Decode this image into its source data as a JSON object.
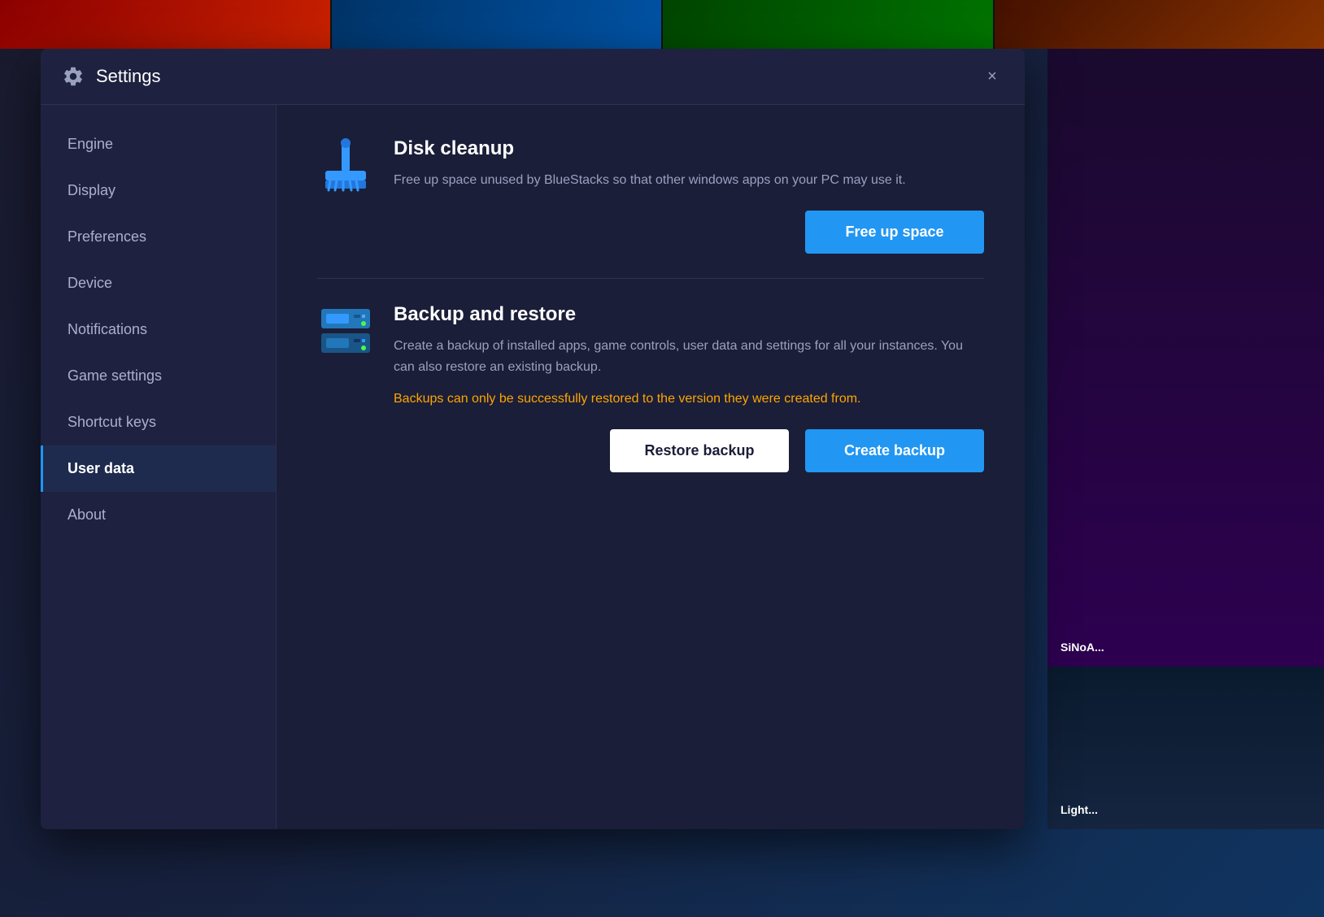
{
  "window": {
    "title": "Settings",
    "close_label": "×"
  },
  "sidebar": {
    "items": [
      {
        "id": "engine",
        "label": "Engine",
        "active": false
      },
      {
        "id": "display",
        "label": "Display",
        "active": false
      },
      {
        "id": "preferences",
        "label": "Preferences",
        "active": false
      },
      {
        "id": "device",
        "label": "Device",
        "active": false
      },
      {
        "id": "notifications",
        "label": "Notifications",
        "active": false
      },
      {
        "id": "game-settings",
        "label": "Game settings",
        "active": false
      },
      {
        "id": "shortcut-keys",
        "label": "Shortcut keys",
        "active": false
      },
      {
        "id": "user-data",
        "label": "User data",
        "active": true
      },
      {
        "id": "about",
        "label": "About",
        "active": false
      }
    ]
  },
  "disk_cleanup": {
    "title": "Disk cleanup",
    "description": "Free up space unused by BlueStacks so that other windows apps on your PC may use it.",
    "button_label": "Free up space"
  },
  "backup_restore": {
    "title": "Backup and restore",
    "description": "Create a backup of installed apps, game controls, user data and settings for all your instances. You can also restore an existing backup.",
    "warning": "Backups can only be successfully restored to the version they were created from.",
    "restore_button": "Restore backup",
    "create_button": "Create backup"
  },
  "right_panel": {
    "top_label": "SiNoA...",
    "bottom_label": "Light..."
  }
}
